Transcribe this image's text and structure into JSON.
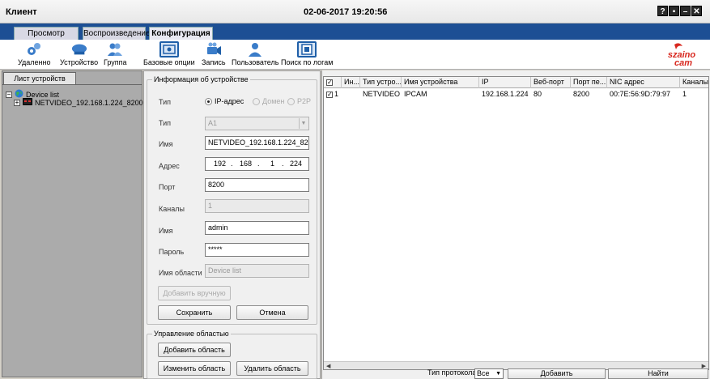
{
  "window": {
    "title": "Клиент",
    "datetime": "02-06-2017 19:20:56",
    "buttons": [
      "?",
      "▪",
      "–",
      "✕"
    ]
  },
  "tabs": [
    {
      "label": "Просмотр",
      "active": false
    },
    {
      "label": "Воспроизведение",
      "active": false
    },
    {
      "label": "Конфигурация",
      "active": true
    }
  ],
  "toolbar": {
    "items": [
      {
        "label": "Удаленно",
        "icon": "remote-icon"
      },
      {
        "label": "Устройство",
        "icon": "device-icon"
      },
      {
        "label": "Группа",
        "icon": "group-icon"
      },
      {
        "label": "Базовые опции",
        "icon": "basic-options-icon"
      },
      {
        "label": "Запись",
        "icon": "record-icon"
      },
      {
        "label": "Пользователь",
        "icon": "user-icon"
      },
      {
        "label": "Поиск по логам",
        "icon": "log-search-icon"
      }
    ],
    "brand": "szaino cam"
  },
  "device_tree": {
    "tab_label": "Лист устройств",
    "root_label": "Device list",
    "child_label": "NETVIDEO_192.168.1.224_8200"
  },
  "device_info": {
    "group_title": "Информация об устройстве",
    "type_label": "Тип",
    "type_options": [
      "IP-адрес",
      "Домен",
      "P2P"
    ],
    "type2_label": "Тип",
    "type2_value": "A1",
    "name_label": "Имя",
    "name_value": "NETVIDEO_192.168.1.224_8200",
    "address_label": "Адрес",
    "address_octets": [
      "192",
      "168",
      "1",
      "224"
    ],
    "port_label": "Порт",
    "port_value": "8200",
    "channels_label": "Каналы",
    "channels_value": "1",
    "user_label": "Имя",
    "user_value": "admin",
    "password_label": "Пароль",
    "password_value": "*****",
    "area_label": "Имя области",
    "area_value": "Device list",
    "add_manual_label": "Добавить вручную",
    "save_label": "Сохранить",
    "cancel_label": "Отмена"
  },
  "area_management": {
    "group_title": "Управление областью",
    "add_label": "Добавить область",
    "edit_label": "Изменить область",
    "delete_label": "Удалить область"
  },
  "device_table": {
    "columns": [
      "Ин...",
      "Тип устро...",
      "Имя устройства",
      "IP",
      "Веб-порт",
      "Порт пе...",
      "NIC адрес",
      "Каналы"
    ],
    "rows": [
      {
        "checked": true,
        "index": "1",
        "type": "NETVIDEO",
        "name": "IPCAM",
        "ip": "192.168.1.224",
        "web_port": "80",
        "port": "8200",
        "mac": "00:7E:56:9D:79:97",
        "channels": "1"
      }
    ]
  },
  "search_bar": {
    "protocol_label": "Тип протокола",
    "protocol_value": "Все",
    "add_label": "Добавить",
    "find_label": "Найти"
  }
}
